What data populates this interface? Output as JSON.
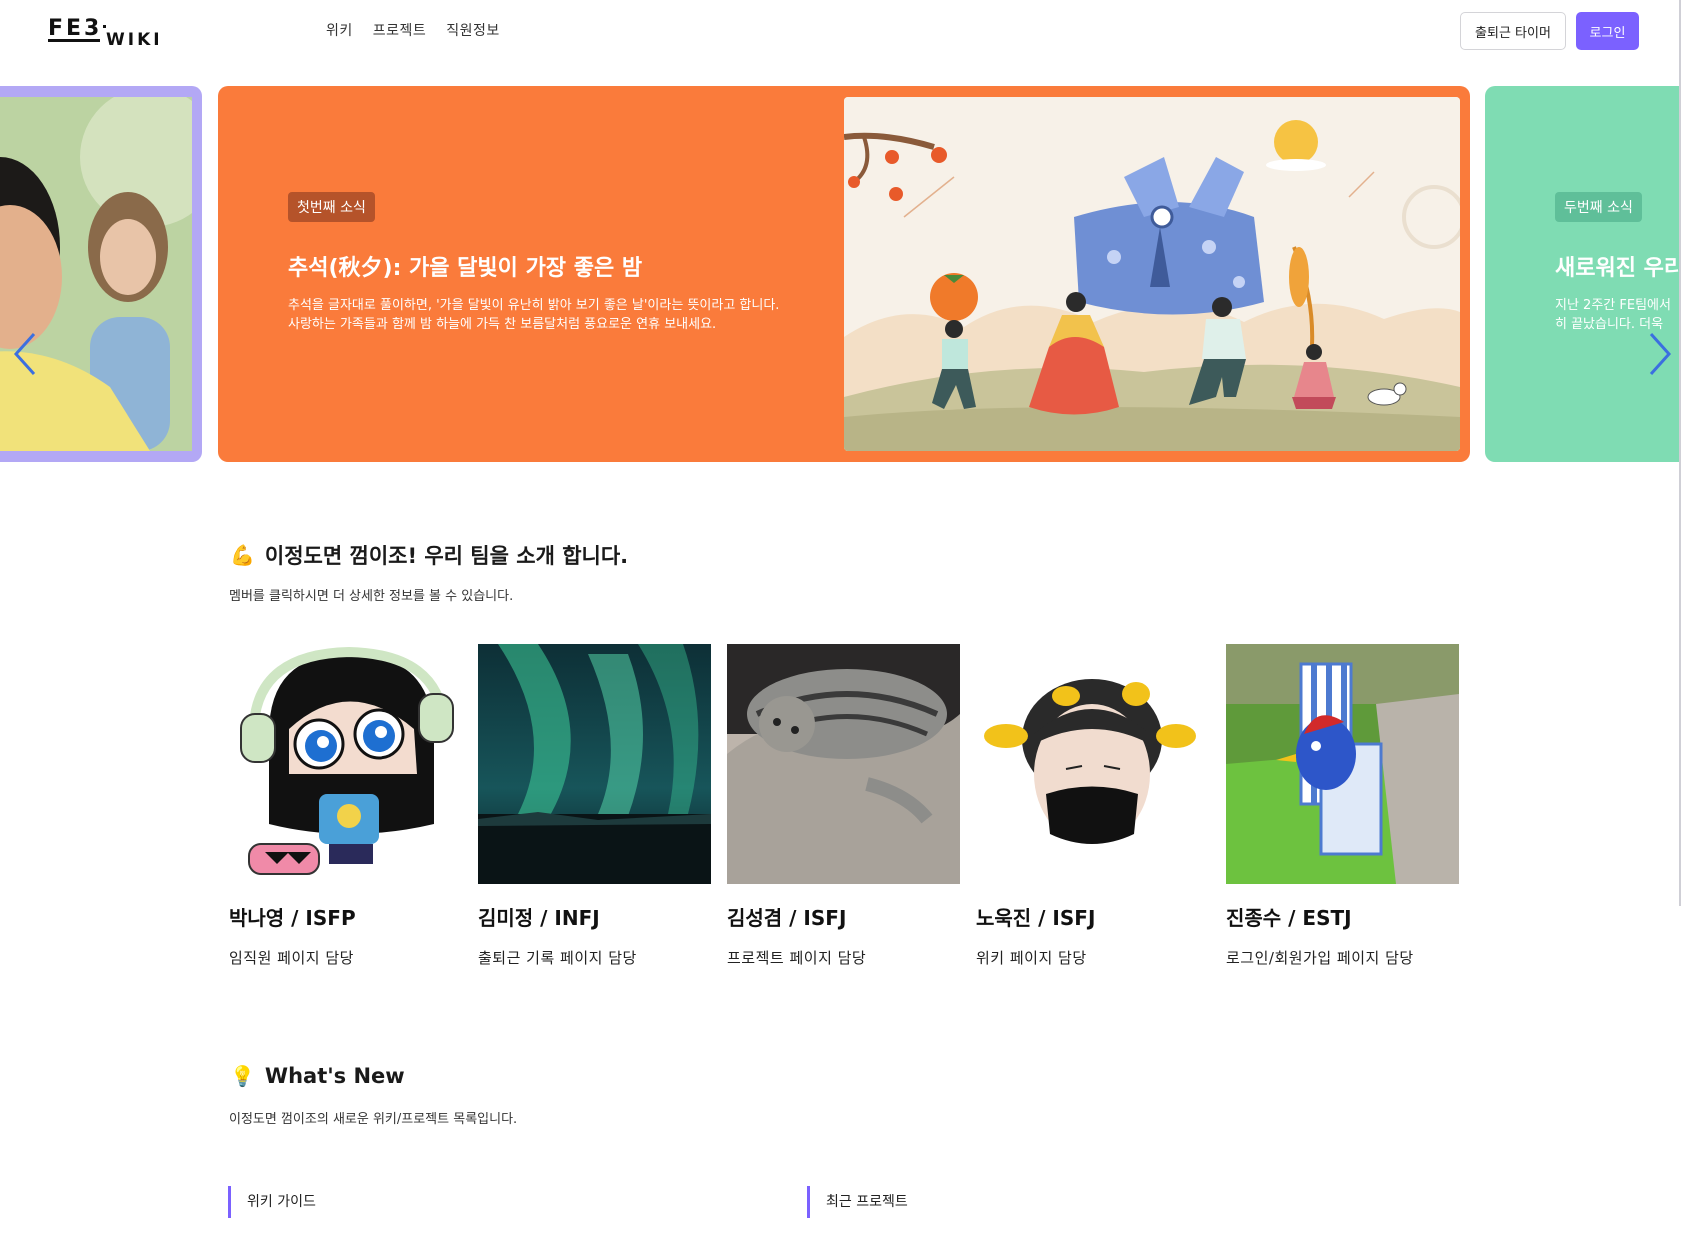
{
  "header": {
    "logo_text": "FE3 WIKI",
    "nav": [
      "위키",
      "프로젝트",
      "직원정보"
    ],
    "timer_button": "출퇴근 타이머",
    "login_button": "로그인"
  },
  "carousel": {
    "main": {
      "badge": "첫번째 소식",
      "title": "추석(秋夕): 가을 달빛이 가장 좋은 밤",
      "description": "추석을 글자대로 풀이하면, '가을 달빛이 유난히 밝아 보기 좋은 날'이라는 뜻이라고 합니다. 사랑하는 가족들과 함께 밤 하늘에 가득 찬 보름달처럼 풍요로운 연휴 보내세요.",
      "color": "#fa7b3b"
    },
    "next": {
      "badge": "두번째 소식",
      "title": "새로워진 우리",
      "description_line1": "지난 2주간 FE팀에서",
      "description_line2": "히 끝났습니다. 더욱",
      "color": "#7fdcb3"
    },
    "prev": {
      "color": "#b3a8f5"
    }
  },
  "team": {
    "title": "이정도면 껌이조! 우리 팀을 소개 합니다.",
    "subtitle": "멤버를 클릭하시면 더 상세한 정보를 볼 수 있습니다.",
    "members": [
      {
        "name": "박나영 / ISFP",
        "role": "임직원 페이지 담당"
      },
      {
        "name": "김미정 / INFJ",
        "role": "출퇴근 기록 페이지 담당"
      },
      {
        "name": "김성겸 / ISFJ",
        "role": "프로젝트 페이지 담당"
      },
      {
        "name": "노욱진 / ISFJ",
        "role": "위키 페이지 담당"
      },
      {
        "name": "진종수 / ESTJ",
        "role": "로그인/회원가입 페이지 담당"
      }
    ]
  },
  "whats_new": {
    "title": "What's New",
    "subtitle": "이정도면 껌이조의 새로운 위키/프로젝트 목록입니다.",
    "columns": [
      "위키 가이드",
      "최근 프로젝트"
    ]
  },
  "accent": "#7b61ff"
}
